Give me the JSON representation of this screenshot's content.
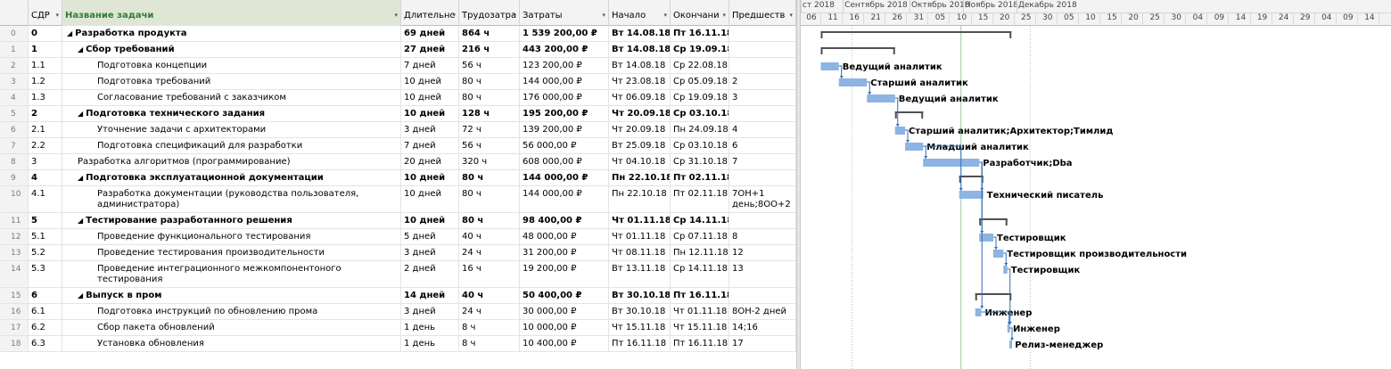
{
  "colors": {
    "bar": "#8db4e2",
    "summary": "#505050",
    "arrow": "#2f6fb3",
    "status_line": "#9bc89b",
    "header_green": "#2e7d32"
  },
  "grid_headers": [
    {
      "key": "rn",
      "label": "",
      "w": 0
    },
    {
      "key": "wbs",
      "label": "СДР",
      "caret": "▾"
    },
    {
      "key": "name",
      "label": "Название задачи",
      "caret": "▾"
    },
    {
      "key": "dur",
      "label": "Длительнс",
      "caret": "▾"
    },
    {
      "key": "work",
      "label": "Трудозатра",
      "caret": "▾"
    },
    {
      "key": "cost",
      "label": "Затраты",
      "caret": "▾"
    },
    {
      "key": "start",
      "label": "Начало",
      "caret": "▾"
    },
    {
      "key": "finish",
      "label": "Окончани",
      "caret": "▾"
    },
    {
      "key": "pred",
      "label": "Предшеств",
      "caret": "▾"
    }
  ],
  "tasks": [
    {
      "rn": "0",
      "wbs": "0",
      "name": "Разработка продукта",
      "level": 0,
      "summary": true,
      "dur": "69 дней",
      "work": "864 ч",
      "cost": "1 539 200,00 ₽",
      "start": "Вт 14.08.18",
      "finish": "Пт 16.11.18",
      "pred": ""
    },
    {
      "rn": "1",
      "wbs": "1",
      "name": "Сбор требований",
      "level": 1,
      "summary": true,
      "dur": "27 дней",
      "work": "216 ч",
      "cost": "443 200,00 ₽",
      "start": "Вт 14.08.18",
      "finish": "Ср 19.09.18",
      "pred": ""
    },
    {
      "rn": "2",
      "wbs": "1.1",
      "name": "Подготовка концепции",
      "level": 2,
      "summary": false,
      "dur": "7 дней",
      "work": "56 ч",
      "cost": "123 200,00 ₽",
      "start": "Вт 14.08.18",
      "finish": "Ср 22.08.18",
      "pred": "",
      "resource": "Ведущий аналитик"
    },
    {
      "rn": "3",
      "wbs": "1.2",
      "name": "Подготовка требований",
      "level": 2,
      "summary": false,
      "dur": "10 дней",
      "work": "80 ч",
      "cost": "144 000,00 ₽",
      "start": "Чт 23.08.18",
      "finish": "Ср 05.09.18",
      "pred": "2",
      "resource": "Старший аналитик"
    },
    {
      "rn": "4",
      "wbs": "1.3",
      "name": "Согласование требований с заказчиком",
      "level": 2,
      "summary": false,
      "dur": "10 дней",
      "work": "80 ч",
      "cost": "176 000,00 ₽",
      "start": "Чт 06.09.18",
      "finish": "Ср 19.09.18",
      "pred": "3",
      "resource": "Ведущий аналитик"
    },
    {
      "rn": "5",
      "wbs": "2",
      "name": "Подготовка технического задания",
      "level": 1,
      "summary": true,
      "dur": "10 дней",
      "work": "128 ч",
      "cost": "195 200,00 ₽",
      "start": "Чт 20.09.18",
      "finish": "Ср 03.10.18",
      "pred": ""
    },
    {
      "rn": "6",
      "wbs": "2.1",
      "name": "Уточнение задачи с архитекторами",
      "level": 2,
      "summary": false,
      "dur": "3 дней",
      "work": "72 ч",
      "cost": "139 200,00 ₽",
      "start": "Чт 20.09.18",
      "finish": "Пн 24.09.18",
      "pred": "4",
      "resource": "Старший аналитик;Архитектор;Тимлид"
    },
    {
      "rn": "7",
      "wbs": "2.2",
      "name": "Подготовка спецификаций для разработки",
      "level": 2,
      "summary": false,
      "dur": "7 дней",
      "work": "56 ч",
      "cost": "56 000,00 ₽",
      "start": "Вт 25.09.18",
      "finish": "Ср 03.10.18",
      "pred": "6",
      "resource": "Младший аналитик"
    },
    {
      "rn": "8",
      "wbs": "3",
      "name": "Разработка алгоритмов (программирование)",
      "level": 1,
      "summary": false,
      "dur": "20 дней",
      "work": "320 ч",
      "cost": "608 000,00 ₽",
      "start": "Чт 04.10.18",
      "finish": "Ср 31.10.18",
      "pred": "7",
      "resource": "Разработчик;Dba"
    },
    {
      "rn": "9",
      "wbs": "4",
      "name": "Подготовка эксплуатационной документации",
      "level": 1,
      "summary": true,
      "dur": "10 дней",
      "work": "80 ч",
      "cost": "144 000,00 ₽",
      "start": "Пн 22.10.18",
      "finish": "Пт 02.11.18",
      "pred": ""
    },
    {
      "rn": "10",
      "wbs": "4.1",
      "name": "Разработка документации (руководства пользователя, администратора)",
      "level": 2,
      "summary": false,
      "dur": "10 дней",
      "work": "80 ч",
      "cost": "144 000,00 ₽",
      "start": "Пн 22.10.18",
      "finish": "Пт 02.11.18",
      "pred": "7ОН+1 день;8ОО+2",
      "resource": "Технический писатель",
      "tall": true
    },
    {
      "rn": "11",
      "wbs": "5",
      "name": "Тестирование разработанного решения",
      "level": 1,
      "summary": true,
      "dur": "10 дней",
      "work": "80 ч",
      "cost": "98 400,00 ₽",
      "start": "Чт 01.11.18",
      "finish": "Ср 14.11.18",
      "pred": ""
    },
    {
      "rn": "12",
      "wbs": "5.1",
      "name": "Проведение функционального тестирования",
      "level": 2,
      "summary": false,
      "dur": "5 дней",
      "work": "40 ч",
      "cost": "48 000,00 ₽",
      "start": "Чт 01.11.18",
      "finish": "Ср 07.11.18",
      "pred": "8",
      "resource": "Тестировщик"
    },
    {
      "rn": "13",
      "wbs": "5.2",
      "name": "Проведение тестирования производительности",
      "level": 2,
      "summary": false,
      "dur": "3 дней",
      "work": "24 ч",
      "cost": "31 200,00 ₽",
      "start": "Чт 08.11.18",
      "finish": "Пн 12.11.18",
      "pred": "12",
      "resource": "Тестировщик производительности"
    },
    {
      "rn": "14",
      "wbs": "5.3",
      "name": "Проведение интеграционного межкомпонентоного тестирования",
      "level": 2,
      "summary": false,
      "dur": "2 дней",
      "work": "16 ч",
      "cost": "19 200,00 ₽",
      "start": "Вт 13.11.18",
      "finish": "Ср 14.11.18",
      "pred": "13",
      "resource": "Тестировщик",
      "tall": true
    },
    {
      "rn": "15",
      "wbs": "6",
      "name": "Выпуск в пром",
      "level": 1,
      "summary": true,
      "dur": "14 дней",
      "work": "40 ч",
      "cost": "50 400,00 ₽",
      "start": "Вт 30.10.18",
      "finish": "Пт 16.11.18",
      "pred": ""
    },
    {
      "rn": "16",
      "wbs": "6.1",
      "name": "Подготовка инструкций по обновлению прома",
      "level": 2,
      "summary": false,
      "dur": "3 дней",
      "work": "24 ч",
      "cost": "30 000,00 ₽",
      "start": "Вт 30.10.18",
      "finish": "Чт 01.11.18",
      "pred": "8ОН-2 дней",
      "resource": "Инженер"
    },
    {
      "rn": "17",
      "wbs": "6.2",
      "name": "Сбор пакета обновлений",
      "level": 2,
      "summary": false,
      "dur": "1 день",
      "work": "8 ч",
      "cost": "10 000,00 ₽",
      "start": "Чт 15.11.18",
      "finish": "Чт 15.11.18",
      "pred": "14;16",
      "resource": "Инженер"
    },
    {
      "rn": "18",
      "wbs": "6.3",
      "name": "Установка обновления",
      "level": 2,
      "summary": false,
      "dur": "1 день",
      "work": "8 ч",
      "cost": "10 400,00 ₽",
      "start": "Пт 16.11.18",
      "finish": "Пт 16.11.18",
      "pred": "17",
      "resource": "Релиз-менеджер"
    }
  ],
  "timeline": {
    "origin_date": "2018-08-04",
    "months": [
      {
        "label": "ст 2018",
        "start": "2018-08-04"
      },
      {
        "label": "Сентябрь 2018",
        "start": "2018-08-26"
      },
      {
        "label": "Октябрь 2018",
        "start": "2018-09-30"
      },
      {
        "label": "Ноябрь 2018",
        "start": "2018-10-28"
      },
      {
        "label": "Декабрь 2018",
        "start": "2018-11-25"
      }
    ],
    "day_labels": [
      "06",
      "11",
      "16",
      "21",
      "26",
      "31",
      "05",
      "10",
      "15",
      "20",
      "25",
      "30",
      "05",
      "10",
      "15",
      "20",
      "25",
      "30",
      "04",
      "09",
      "14",
      "19",
      "24",
      "29",
      "04",
      "09",
      "14"
    ],
    "status_date": "2018-10-27"
  }
}
